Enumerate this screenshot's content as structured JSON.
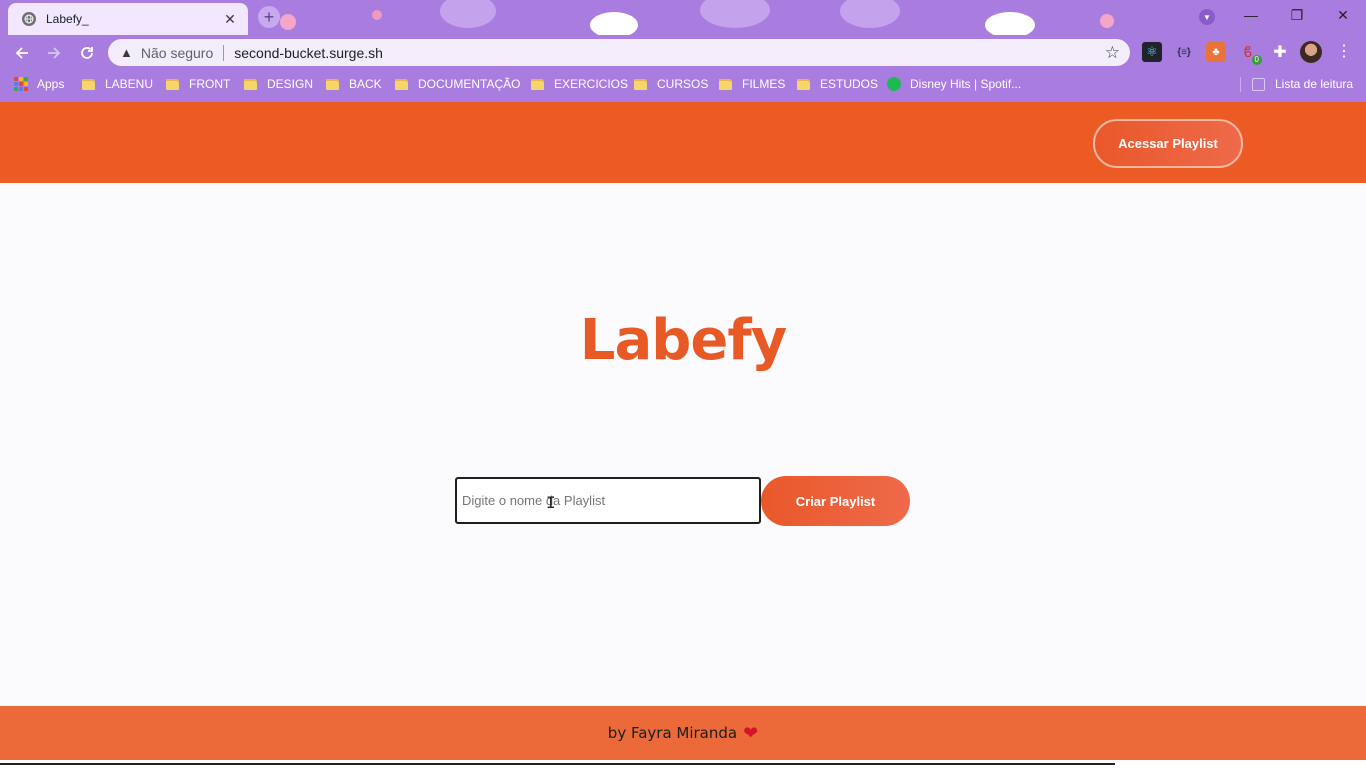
{
  "browser": {
    "tab_title": "Labefy_",
    "tab_close": "✕",
    "new_tab": "+",
    "window_controls": [
      "—",
      "❐",
      "✕"
    ],
    "security_label": "Não seguro",
    "url": "second-bucket.surge.sh",
    "extensions": [
      "react-devtools-icon",
      "json-viewer-icon",
      "orange-extension-icon",
      "red-extension-icon",
      "puzzle-icon"
    ],
    "extension_badge": "0",
    "bookmarks": [
      {
        "label": "Apps",
        "type": "apps"
      },
      {
        "label": "LABENU",
        "type": "folder"
      },
      {
        "label": "FRONT",
        "type": "folder"
      },
      {
        "label": "DESIGN",
        "type": "folder"
      },
      {
        "label": "BACK",
        "type": "folder"
      },
      {
        "label": "DOCUMENTAÇÃO",
        "type": "folder"
      },
      {
        "label": "EXERCICIOS",
        "type": "folder"
      },
      {
        "label": "CURSOS",
        "type": "folder"
      },
      {
        "label": "FILMES",
        "type": "folder"
      },
      {
        "label": "ESTUDOS",
        "type": "folder"
      },
      {
        "label": "Disney Hits | Spotif...",
        "type": "spotify"
      }
    ],
    "reading_list": "Lista de leitura",
    "theme_color": "#a97de0"
  },
  "page": {
    "header": {
      "access_button": "Acessar Playlist"
    },
    "logo": "Labefy",
    "form": {
      "input_value": "",
      "input_placeholder": "Digite o nome da Playlist",
      "create_button": "Criar Playlist"
    },
    "footer": {
      "credit": "by Fayra Miranda",
      "heart": "❤"
    },
    "accent_color": "#ec5b24"
  }
}
